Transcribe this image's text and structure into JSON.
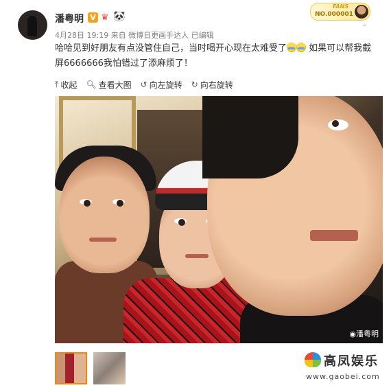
{
  "post": {
    "username": "潘粤明",
    "verified_badge": "V",
    "meta": "4月28日 19:19 来自 微博日更画手达人  已编辑",
    "text": "哈哈见到好朋友有点没管住自己，当时喝开心现在太难受了",
    "text_after_emoji": " 如果可以帮我截屏6666666我怕错过了添麻烦了！",
    "fans_badge": {
      "title": "FANS",
      "number": "NO.000001"
    }
  },
  "toolbar": {
    "collapse": "收起",
    "view_large": "查看大图",
    "rotate_left": "向左旋转",
    "rotate_right": "向右旋转"
  },
  "photo": {
    "watermark": "潘粤明"
  },
  "site_logo": {
    "name": "高凤娱乐",
    "url": "www.gaobei.com"
  },
  "icons": {
    "collapse": "collapse-up-icon",
    "view_large": "magnifier-icon",
    "rotate_left": "rotate-left-icon",
    "rotate_right": "rotate-right-icon"
  }
}
